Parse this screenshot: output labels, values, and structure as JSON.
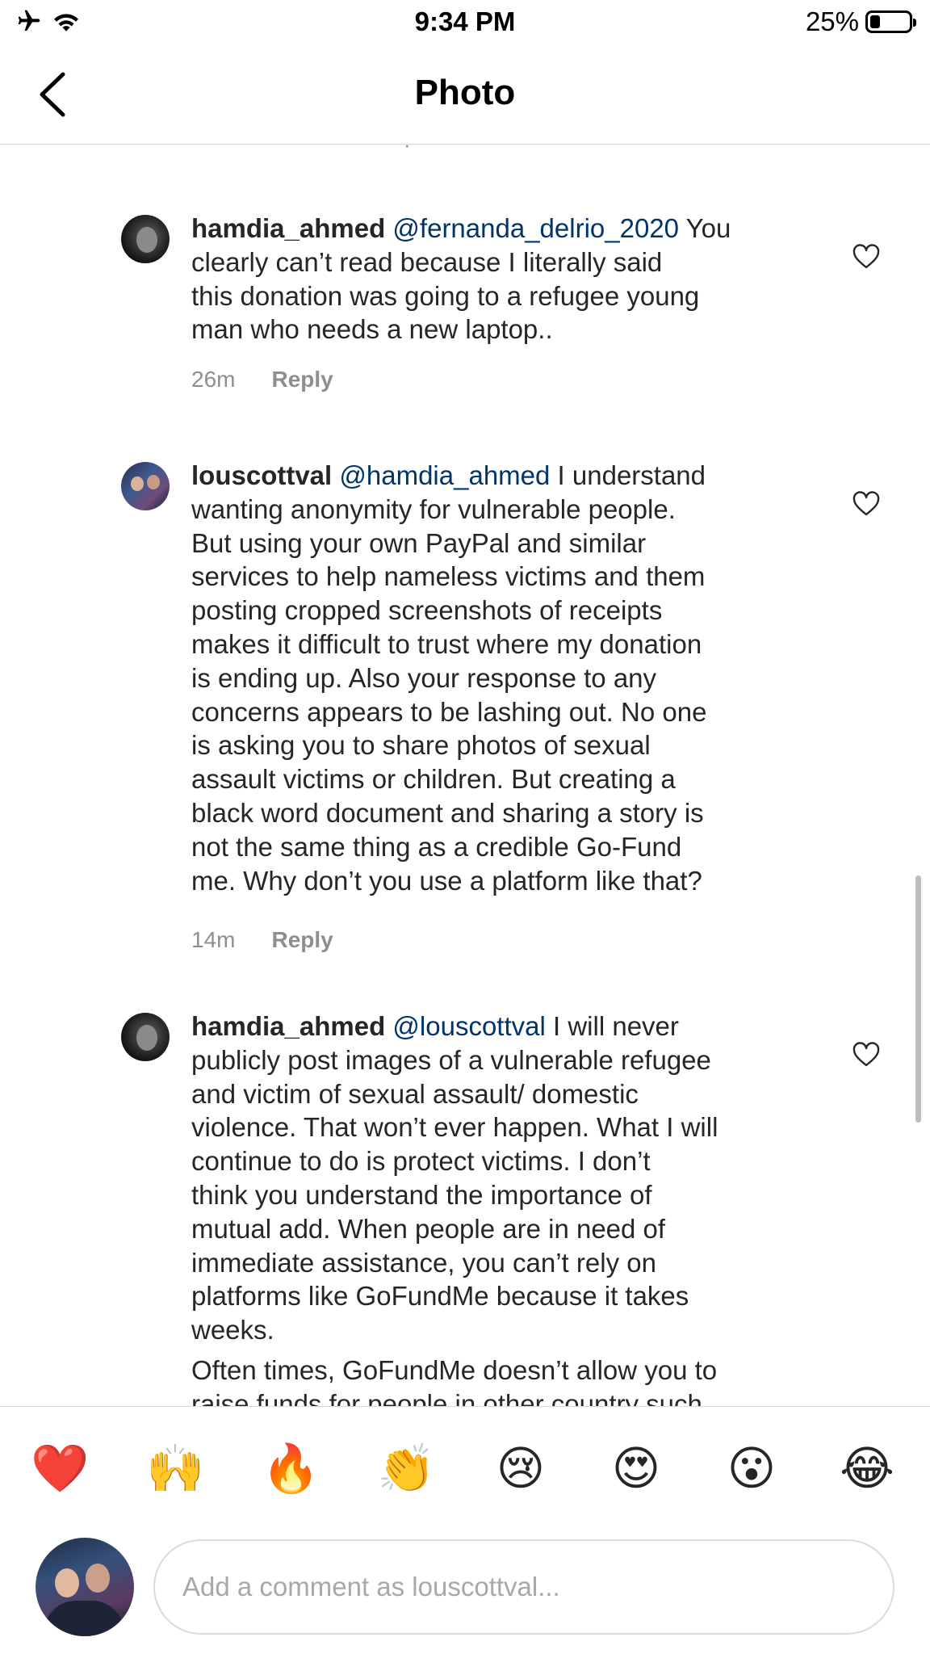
{
  "status_bar": {
    "time": "9:34 PM",
    "battery_percent_text": "25%",
    "battery_level": 0.25,
    "icons": [
      "airplane-icon",
      "wifi-icon",
      "battery-icon"
    ]
  },
  "nav": {
    "title": "Photo",
    "back_icon": "chevron-left-icon"
  },
  "comments": [
    {
      "username": "hamdia_ahmed",
      "mention": "@fernanda_delrio_2020",
      "text": " You clearly can’t read because I literally said\nthis donation was going to a refugee young\nman who needs a new laptop..",
      "time": "26m",
      "reply_label": "Reply"
    },
    {
      "username": "louscottval",
      "mention": "@hamdia_ahmed",
      "text": " I understand\nwanting anonymity for vulnerable people.\nBut using  your own PayPal and similar\nservices to help nameless victims and them\nposting cropped screenshots of receipts\nmakes it difficult to trust where my donation\nis ending up. Also your response to any\nconcerns appears to be lashing out. No one\nis asking you to share photos of sexual\nassault victims or children.  But creating a\nblack word document and sharing a story is\nnot the same thing as a credible Go-Fund\nme. Why don’t you use a platform like that?",
      "time": "14m",
      "reply_label": "Reply"
    },
    {
      "username": "hamdia_ahmed",
      "mention": "@louscottval",
      "text": "  I will never\npublicly post images of a vulnerable refugee\nand victim of sexual assault/ domestic\nviolence. That won’t ever happen. What I will\ncontinue  to do is protect victims. I don’t\nthink you understand the importance of\nmutual add. When people are in need of\nimmediate assistance, you can’t rely on\nplatforms like GoFundMe because it takes\nweeks.",
      "continuation": "Often times, GoFundMe doesn’t allow you to\nraise funds for people in other country such",
      "time": "",
      "reply_label": ""
    }
  ],
  "emoji_bar": [
    "❤️",
    "🙌",
    "🔥",
    "👏",
    "😢",
    "😍",
    "😮",
    "😂"
  ],
  "composer": {
    "placeholder": "Add a comment as louscottval..."
  },
  "colors": {
    "text": "#262626",
    "mention": "#003569",
    "meta": "#8e8e8e",
    "divider": "#dbdbdb"
  }
}
